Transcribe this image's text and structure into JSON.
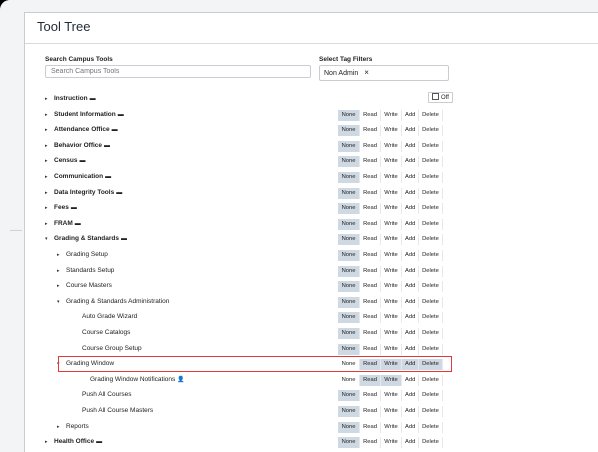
{
  "title": "Tool Tree",
  "search": {
    "label": "Search Campus Tools",
    "placeholder": "Search Campus Tools"
  },
  "tags": {
    "label": "Select Tag Filters",
    "selected": "Non Admin",
    "remove": "×"
  },
  "off_button": "Off",
  "perm_labels": [
    "None",
    "Read",
    "Write",
    "Add",
    "Delete"
  ],
  "rows": [
    {
      "label": "Instruction",
      "caret": "▸",
      "folder": true,
      "bold": true,
      "selected": []
    },
    {
      "label": "Student Information",
      "caret": "▸",
      "folder": true,
      "bold": true,
      "selected": [
        "None"
      ]
    },
    {
      "label": "Attendance Office",
      "caret": "▸",
      "folder": true,
      "bold": true,
      "selected": [
        "None"
      ]
    },
    {
      "label": "Behavior Office",
      "caret": "▸",
      "folder": true,
      "bold": true,
      "selected": [
        "None"
      ]
    },
    {
      "label": "Census",
      "caret": "▸",
      "folder": true,
      "bold": true,
      "selected": [
        "None"
      ]
    },
    {
      "label": "Communication",
      "caret": "▸",
      "folder": true,
      "bold": true,
      "selected": [
        "None"
      ]
    },
    {
      "label": "Data Integrity Tools",
      "caret": "▸",
      "folder": true,
      "bold": true,
      "selected": [
        "None"
      ]
    },
    {
      "label": "Fees",
      "caret": "▸",
      "folder": true,
      "bold": true,
      "selected": [
        "None"
      ]
    },
    {
      "label": "FRAM",
      "caret": "▸",
      "folder": true,
      "bold": true,
      "selected": [
        "None"
      ]
    },
    {
      "label": "Grading & Standards",
      "caret": "▾",
      "folder": true,
      "bold": true,
      "selected": [
        "None"
      ]
    },
    {
      "label": "Grading Setup",
      "caret": "▸",
      "folder": false,
      "bold": false,
      "indent": 1,
      "selected": [
        "None"
      ]
    },
    {
      "label": "Standards Setup",
      "caret": "▸",
      "folder": false,
      "bold": false,
      "indent": 1,
      "selected": [
        "None"
      ]
    },
    {
      "label": "Course Masters",
      "caret": "▸",
      "folder": false,
      "bold": false,
      "indent": 1,
      "selected": [
        "None"
      ]
    },
    {
      "label": "Grading & Standards Administration",
      "caret": "▾",
      "folder": false,
      "bold": false,
      "indent": 1,
      "selected": [
        "None"
      ]
    },
    {
      "label": "Auto Grade Wizard",
      "caret": "",
      "folder": false,
      "bold": false,
      "indent": 2,
      "selected": [
        "None"
      ]
    },
    {
      "label": "Course Catalogs",
      "caret": "",
      "folder": false,
      "bold": false,
      "indent": 2,
      "selected": [
        "None"
      ]
    },
    {
      "label": "Course Group Setup",
      "caret": "",
      "folder": false,
      "bold": false,
      "indent": 2,
      "selected": [
        "None"
      ]
    },
    {
      "label": "Grading Window",
      "caret": "▾",
      "folder": false,
      "bold": false,
      "indent": 1,
      "selected": [
        "Read",
        "Write",
        "Add",
        "Delete"
      ]
    },
    {
      "label": "Grading Window Notifications",
      "caret": "",
      "folder": false,
      "bold": false,
      "indent": 3,
      "user_icon": true,
      "selected": [
        "Read",
        "Write"
      ]
    },
    {
      "label": "Push All Courses",
      "caret": "",
      "folder": false,
      "bold": false,
      "indent": 2,
      "selected": [
        "None"
      ]
    },
    {
      "label": "Push All Course Masters",
      "caret": "",
      "folder": false,
      "bold": false,
      "indent": 2,
      "selected": [
        "None"
      ]
    },
    {
      "label": "Reports",
      "caret": "▸",
      "folder": false,
      "bold": false,
      "indent": 1,
      "selected": [
        "None"
      ]
    },
    {
      "label": "Health Office",
      "caret": "▸",
      "folder": true,
      "bold": true,
      "selected": [
        "None"
      ]
    }
  ],
  "highlighted_row": "Grading Window"
}
